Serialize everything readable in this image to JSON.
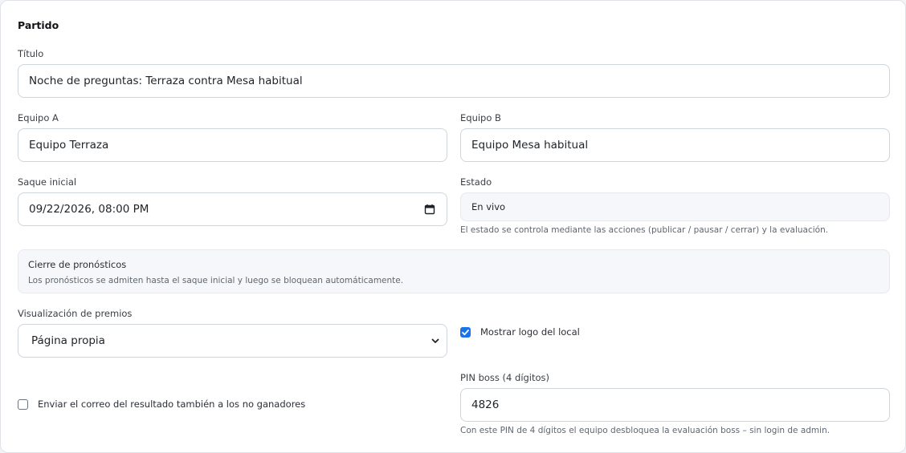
{
  "section": {
    "title": "Partido"
  },
  "fields": {
    "titulo": {
      "label": "Título",
      "value": "Noche de preguntas: Terraza contra Mesa habitual"
    },
    "equipo_a": {
      "label": "Equipo A",
      "value": "Equipo Terraza"
    },
    "equipo_b": {
      "label": "Equipo B",
      "value": "Equipo Mesa habitual"
    },
    "saque_inicial": {
      "label": "Saque inicial",
      "value": "09/22/2026, 08:00 PM"
    },
    "estado": {
      "label": "Estado",
      "value": "En vivo",
      "help": "El estado se controla mediante las acciones (publicar / pausar / cerrar) y la evaluación."
    },
    "cierre": {
      "title": "Cierre de pronósticos",
      "text": "Los pronósticos se admiten hasta el saque inicial y luego se bloquean automáticamente."
    },
    "visualizacion": {
      "label": "Visualización de premios",
      "value": "Página propia"
    },
    "mostrar_logo": {
      "label": "Mostrar logo del local",
      "checked": true
    },
    "enviar_correo": {
      "label": "Enviar el correo del resultado también a los no ganadores",
      "checked": false
    },
    "pin": {
      "label": "PIN boss (4 dígitos)",
      "value": "4826",
      "help": "Con este PIN de 4 dígitos el equipo desbloquea la evaluación boss – sin login de admin."
    }
  },
  "icons": {
    "calendar": "calendar-icon",
    "select": "chevron-down-icon",
    "check": "check-icon"
  },
  "colors": {
    "accent": "#1a73e8",
    "border": "#cfd5dc",
    "muted_bg": "#f5f7fa"
  }
}
